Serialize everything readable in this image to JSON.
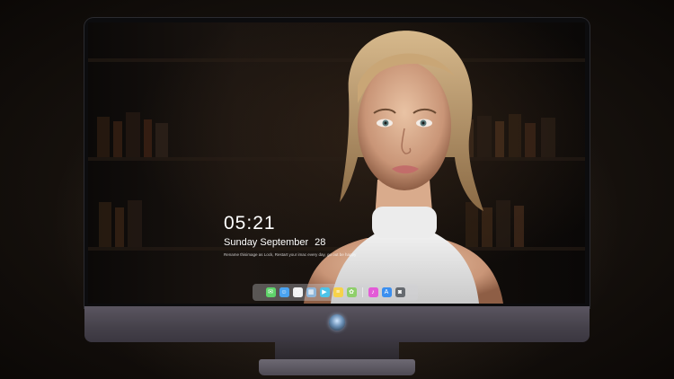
{
  "lock_screen": {
    "time": "05:21",
    "date_text": "Sunday September",
    "day_number": "28",
    "caption": "Rename thisimage as Lock, Restart your imac every day, go out be happy"
  },
  "dock": {
    "apps": [
      {
        "name": "messages-icon",
        "color": "#5fd36a",
        "glyph": "✉"
      },
      {
        "name": "finder-icon",
        "color": "#4aa3f0",
        "glyph": "☺"
      },
      {
        "name": "clock-icon",
        "color": "#f2f2f2",
        "glyph": "◷"
      },
      {
        "name": "preview-icon",
        "color": "#8fb6d9",
        "glyph": "▦"
      },
      {
        "name": "facetime-icon",
        "color": "#4dc3e8",
        "glyph": "▶"
      },
      {
        "name": "notes-icon",
        "color": "#f7d24a",
        "glyph": "≡"
      },
      {
        "name": "photos-icon",
        "color": "#8fcf6b",
        "glyph": "✿"
      },
      {
        "name": "music-icon",
        "color": "#e35bd7",
        "glyph": "♪"
      },
      {
        "name": "app-store-icon",
        "color": "#3b8ff0",
        "glyph": "A"
      },
      {
        "name": "camera-icon",
        "color": "#666a70",
        "glyph": "◙"
      }
    ]
  },
  "colors": {
    "monitor_chin": "#4a4650",
    "screen_bg": "#120e0b"
  }
}
